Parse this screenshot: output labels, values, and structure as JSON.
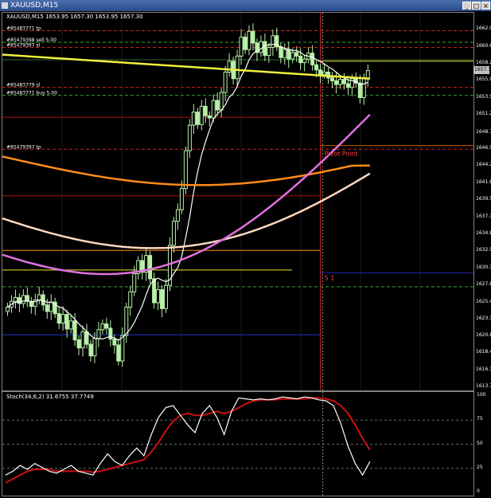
{
  "window": {
    "title": "XAUUSD,M15",
    "min_label": "_",
    "max_label": "□",
    "close_label": "×"
  },
  "header": {
    "symbol": "XAUUSD,M15",
    "ohlc": "1653.95 1657.30 1653.95 1657.30"
  },
  "order_labels": [
    {
      "text": "#85483771 tp",
      "price": 1662.8,
      "color": "#ff4040"
    },
    {
      "text": "#85479398 sell 5.00",
      "price": 1661.2,
      "color": "#33cc33"
    },
    {
      "text": "#85479397 sl",
      "price": 1660.5,
      "color": "#ff4040"
    },
    {
      "text": "#85483779 sl",
      "price": 1655.0,
      "color": "#ff4040"
    },
    {
      "text": "#85483771 buy 5.00",
      "price": 1653.9,
      "color": "#33cc33"
    },
    {
      "text": "#85479397 tp",
      "price": 1646.5,
      "color": "#ff4040"
    }
  ],
  "annotations": {
    "pivot_point": "Pivot Point",
    "s1": "S 1"
  },
  "current_price_label": "1657.30",
  "chart_data": {
    "type": "candlestick",
    "ylim": [
      1613.79,
      1664.6
    ],
    "yticks": [
      "1662.95",
      "1660.60",
      "1658.25",
      "1655.90",
      "1653.55",
      "1651.20",
      "1648.70",
      "1646.55",
      "1644.20",
      "1641.85",
      "1639.50",
      "1637.15",
      "1634.80",
      "1632.50",
      "1630.15",
      "1627.80",
      "1625.45",
      "1623.15",
      "1620.80",
      "1618.45",
      "1616.10",
      "1613.79"
    ],
    "closes": [
      1624.8,
      1625.6,
      1626.1,
      1625.3,
      1626.4,
      1625.6,
      1624.9,
      1625.8,
      1626.5,
      1625.1,
      1624.2,
      1625.5,
      1623.9,
      1622.6,
      1623.8,
      1621.8,
      1622.9,
      1620.3,
      1619.2,
      1621.4,
      1619.7,
      1618.1,
      1620.5,
      1621.7,
      1622.5,
      1621.9,
      1620.4,
      1619.6,
      1617.4,
      1620.9,
      1624.8,
      1626.9,
      1629.4,
      1631.2,
      1629.6,
      1631.9,
      1628.7,
      1625.4,
      1627.2,
      1624.6,
      1627.8,
      1633.3,
      1636.6,
      1638.2,
      1641.1,
      1646.3,
      1649.8,
      1651.6,
      1649.9,
      1652.4,
      1651.1,
      1650.8,
      1653.2,
      1651.9,
      1654.3,
      1657.1,
      1658.6,
      1656.2,
      1659.3,
      1661.9,
      1660.2,
      1662.7,
      1661.1,
      1659.8,
      1661.3,
      1659.4,
      1660.5,
      1662.1,
      1660.6,
      1659.1,
      1660.2,
      1658.9,
      1659.8,
      1659.3,
      1658.4,
      1658.9,
      1659.7,
      1658.1,
      1657.4,
      1656.8,
      1657.1,
      1656.3,
      1655.9,
      1655.4,
      1656.1,
      1655.5,
      1655.0,
      1656.2,
      1655.6,
      1653.6,
      1656.3,
      1657.3
    ],
    "horizontal_levels": [
      {
        "price": 1662.8,
        "color": "#cc2222",
        "style": "dash",
        "from": 0.0
      },
      {
        "price": 1661.2,
        "color": "#33aa33",
        "style": "dash",
        "from": 0.0
      },
      {
        "price": 1660.5,
        "color": "#cc2222",
        "style": "dash",
        "from": 0.0
      },
      {
        "price": 1655.0,
        "color": "#cc2222",
        "style": "dash",
        "from": 0.0
      },
      {
        "price": 1653.9,
        "color": "#33aa33",
        "style": "dash",
        "from": 0.0
      },
      {
        "price": 1646.5,
        "color": "#cc2222",
        "style": "dash",
        "from": 0.0
      },
      {
        "price": 1658.8,
        "color": "#336633",
        "style": "solid",
        "from": 0.0
      },
      {
        "price": 1658.6,
        "color": "#e8e830",
        "style": "solid",
        "from": 0.67
      },
      {
        "price": 1650.9,
        "color": "#aa1111",
        "style": "solid",
        "from": 0.0,
        "to": 0.675
      },
      {
        "price": 1647.0,
        "color": "#cc6600",
        "style": "solid",
        "from": 0.675
      },
      {
        "price": 1640.1,
        "color": "#aa1111",
        "style": "solid",
        "from": 0.0,
        "to": 0.675
      },
      {
        "price": 1632.6,
        "color": "#ff8800",
        "style": "solid",
        "from": 0.0,
        "to": 0.675
      },
      {
        "price": 1629.9,
        "color": "#e8e830",
        "style": "solid",
        "from": 0.0,
        "to": 0.615
      },
      {
        "price": 1629.5,
        "color": "#2222aa",
        "style": "solid",
        "from": 0.675
      },
      {
        "price": 1627.6,
        "color": "#33aa33",
        "style": "dash",
        "from": 0.0
      },
      {
        "price": 1621.0,
        "color": "#2233cc",
        "style": "solid",
        "from": 0.0,
        "to": 0.675
      }
    ]
  },
  "stochastic": {
    "label": "Stoch(34,6,2) 31.6755 37.7749",
    "levels": [
      "100",
      "75",
      "50",
      "25",
      "0"
    ],
    "ylim": [
      0,
      100
    ],
    "main": [
      18,
      22,
      28,
      24,
      30,
      26,
      22,
      20,
      24,
      28,
      22,
      20,
      18,
      30,
      40,
      32,
      28,
      38,
      46,
      38,
      60,
      78,
      88,
      90,
      80,
      70,
      62,
      82,
      90,
      78,
      60,
      84,
      98,
      97,
      96,
      97,
      96,
      97,
      99,
      98,
      97,
      99,
      98,
      96,
      95,
      90,
      72,
      48,
      30,
      18,
      32
    ],
    "signal": [
      10,
      14,
      18,
      22,
      24,
      24,
      24,
      22,
      22,
      22,
      22,
      22,
      21,
      22,
      24,
      26,
      28,
      30,
      32,
      34,
      42,
      52,
      64,
      74,
      80,
      82,
      80,
      80,
      82,
      84,
      82,
      84,
      88,
      92,
      95,
      96,
      96,
      96,
      97,
      97,
      97,
      97,
      98,
      98,
      97,
      95,
      90,
      82,
      70,
      56,
      44
    ]
  }
}
